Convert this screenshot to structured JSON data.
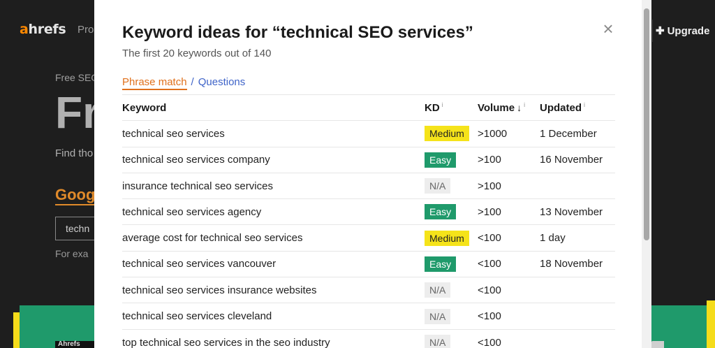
{
  "background": {
    "logo_a": "a",
    "logo_rest": "hrefs",
    "nav_item": "Pro",
    "upgrade_label": "Upgrade",
    "upgrade_icon": "plus-sparkle-icon",
    "eyebrow": "Free SEO",
    "hero": "Fr",
    "subtitle": "Find tho",
    "google_label": "Goog",
    "input_value": "techn",
    "example": "For exa",
    "dark_tag": "Ahrefs"
  },
  "modal": {
    "title": "Keyword ideas for “technical SEO services”",
    "subtitle": "The first 20 keywords out of 140",
    "close_icon": "×",
    "tabs": {
      "active": "Phrase match",
      "separator": "/",
      "other": "Questions"
    },
    "table": {
      "headers": {
        "keyword": "Keyword",
        "kd": "KD",
        "volume": "Volume",
        "volume_sort": "↓",
        "updated": "Updated",
        "info": "i"
      },
      "rows": [
        {
          "keyword": "technical seo services",
          "kd": "Medium",
          "kd_level": "medium",
          "volume": ">1000",
          "updated": "1 December"
        },
        {
          "keyword": "technical seo services company",
          "kd": "Easy",
          "kd_level": "easy",
          "volume": ">100",
          "updated": "16 November"
        },
        {
          "keyword": "insurance technical seo services",
          "kd": "N/A",
          "kd_level": "na",
          "volume": ">100",
          "updated": ""
        },
        {
          "keyword": "technical seo services agency",
          "kd": "Easy",
          "kd_level": "easy",
          "volume": ">100",
          "updated": "13 November"
        },
        {
          "keyword": "average cost for technical seo services",
          "kd": "Medium",
          "kd_level": "medium",
          "volume": "<100",
          "updated": "1 day"
        },
        {
          "keyword": "technical seo services vancouver",
          "kd": "Easy",
          "kd_level": "easy",
          "volume": "<100",
          "updated": "18 November"
        },
        {
          "keyword": "technical seo services insurance websites",
          "kd": "N/A",
          "kd_level": "na",
          "volume": "<100",
          "updated": ""
        },
        {
          "keyword": "technical seo services cleveland",
          "kd": "N/A",
          "kd_level": "na",
          "volume": "<100",
          "updated": ""
        },
        {
          "keyword": "top technical seo services in the seo industry",
          "kd": "N/A",
          "kd_level": "na",
          "volume": "<100",
          "updated": ""
        }
      ]
    }
  },
  "colors": {
    "accent_orange": "#e0701b",
    "link_blue": "#3e63c8",
    "kd_medium": "#f5e31a",
    "kd_easy": "#1f9a6b",
    "kd_na": "#ededed"
  }
}
